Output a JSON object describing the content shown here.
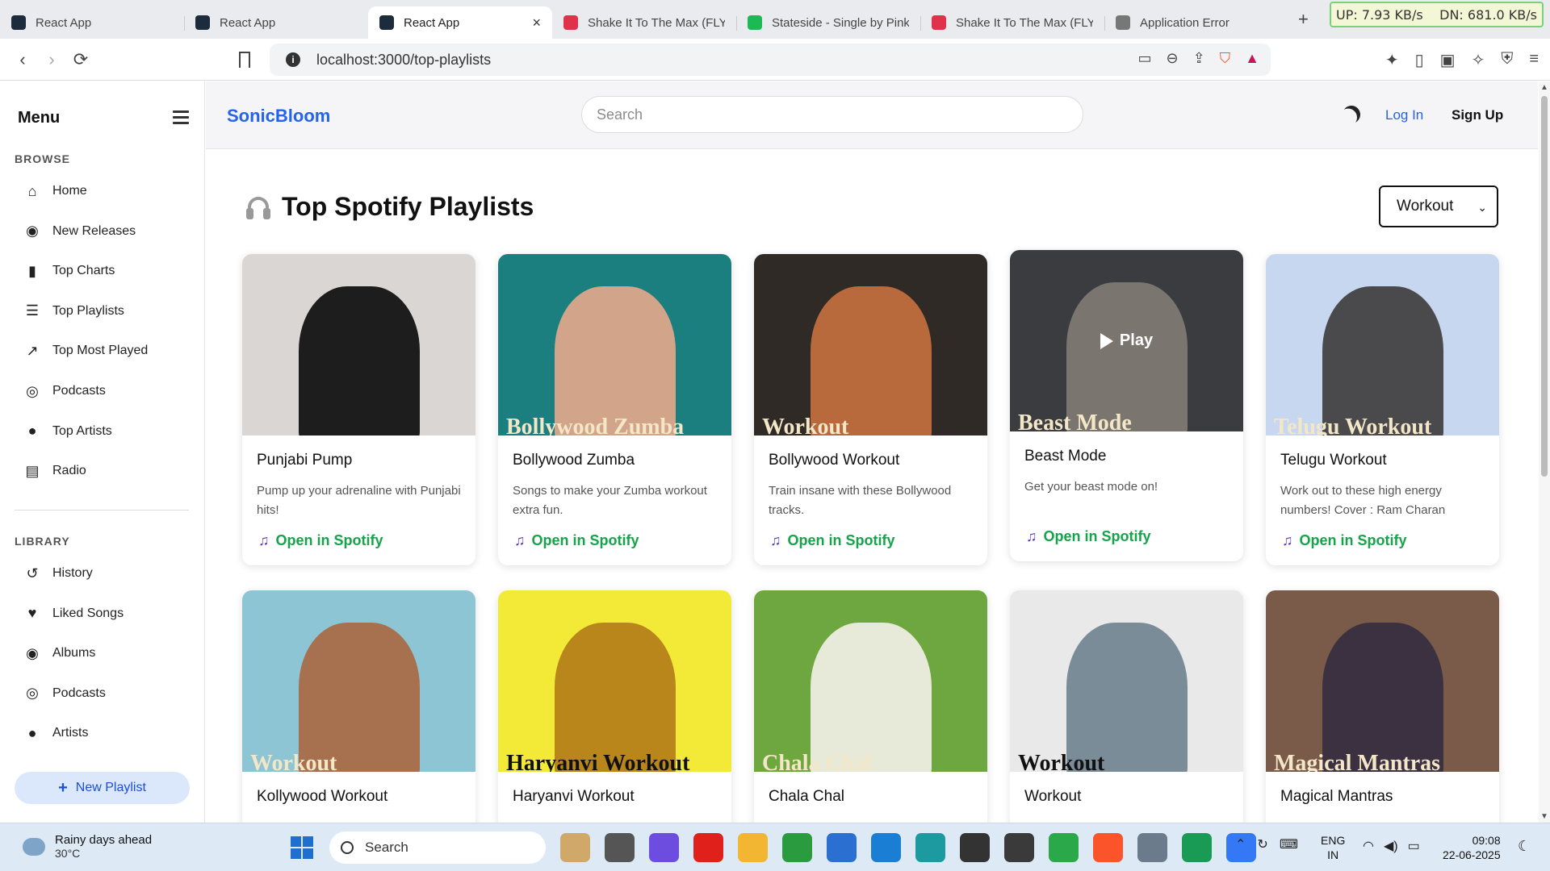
{
  "browser": {
    "tabs": [
      {
        "title": "React App",
        "favicon_color": "#1c2c3c"
      },
      {
        "title": "React App",
        "favicon_color": "#1c2c3c"
      },
      {
        "title": "React App",
        "favicon_color": "#1c2c3c",
        "active": true
      },
      {
        "title": "Shake It To The Max (FLY",
        "favicon_color": "#e1324b"
      },
      {
        "title": "Stateside - Single by Pink",
        "favicon_color": "#1db954"
      },
      {
        "title": "Shake It To The Max (FLY",
        "favicon_color": "#e1324b"
      },
      {
        "title": "Application Error",
        "favicon_color": "#777777"
      }
    ],
    "net_up": "UP: 7.93 KB/s",
    "net_down": "DN: 681.0 KB/s",
    "url": "localhost:3000/top-playlists",
    "new_tab": "+"
  },
  "sidebar": {
    "menu_title": "Menu",
    "browse_label": "BROWSE",
    "browse_items": [
      {
        "label": "Home",
        "icon": "home-icon"
      },
      {
        "label": "New Releases",
        "icon": "compass-icon"
      },
      {
        "label": "Top Charts",
        "icon": "bar-chart-icon"
      },
      {
        "label": "Top Playlists",
        "icon": "playlist-icon"
      },
      {
        "label": "Top Most Played",
        "icon": "trending-icon"
      },
      {
        "label": "Podcasts",
        "icon": "podcast-icon"
      },
      {
        "label": "Top Artists",
        "icon": "user-icon"
      },
      {
        "label": "Radio",
        "icon": "radio-icon"
      }
    ],
    "library_label": "LIBRARY",
    "library_items": [
      {
        "label": "History",
        "icon": "history-icon"
      },
      {
        "label": "Liked Songs",
        "icon": "heart-icon"
      },
      {
        "label": "Albums",
        "icon": "album-icon"
      },
      {
        "label": "Podcasts",
        "icon": "podcast-icon"
      },
      {
        "label": "Artists",
        "icon": "user-icon"
      }
    ],
    "new_playlist_label": "New Playlist"
  },
  "header": {
    "brand": "SonicBloom",
    "search_placeholder": "Search",
    "login_label": "Log In",
    "signup_label": "Sign Up"
  },
  "main": {
    "title": "Top Spotify Playlists",
    "filter_value": "Workout",
    "open_label": "Open in Spotify",
    "play_label": "Play",
    "playlists": [
      {
        "name": "Punjabi Pump",
        "desc": "Pump up your adrenaline with Punjabi hits!",
        "bg": "#d9d6d3",
        "figure": "#1d1d1d",
        "cover_text": ""
      },
      {
        "name": "Bollywood Zumba",
        "desc": "Songs to make your Zumba workout extra fun.",
        "bg": "#1b7f80",
        "figure": "#d2a58a",
        "cover_text": "Bollywood Zumba"
      },
      {
        "name": "Bollywood Workout",
        "desc": "Train insane with these Bollywood tracks.",
        "bg": "#2f2a25",
        "figure": "#b86a3c",
        "cover_text": "Workout"
      },
      {
        "name": "Beast Mode",
        "desc": "Get your beast mode on!",
        "bg": "#3a3c40",
        "figure": "#7b7570",
        "cover_text": "Beast Mode",
        "hover": true
      },
      {
        "name": "Telugu Workout",
        "desc": "Work out to these high energy numbers! Cover : Ram Charan",
        "bg": "#c7d7ef",
        "figure": "#4a4a4d",
        "cover_text": "Telugu Workout"
      },
      {
        "name": "Kollywood Workout",
        "desc": "",
        "bg": "#8ec5d4",
        "figure": "#a7704e",
        "cover_text": "Workout"
      },
      {
        "name": "Haryanvi Workout",
        "desc": "",
        "bg": "#f3ea38",
        "figure": "#b8861b",
        "cover_text": "Haryanvi Workout"
      },
      {
        "name": "Chala Chal",
        "desc": "",
        "bg": "#6ea63f",
        "figure": "#e8ead9",
        "cover_text": "Chala Chal"
      },
      {
        "name": "Workout",
        "desc": "",
        "bg": "#e9e9e9",
        "figure": "#7b8c99",
        "cover_text": "Workout"
      },
      {
        "name": "Magical Mantras",
        "desc": "",
        "bg": "#7a5a48",
        "figure": "#3c3140",
        "cover_text": "Magical Mantras"
      }
    ]
  },
  "taskbar": {
    "weather_title": "Rainy days ahead",
    "weather_temp": "30°C",
    "search_label": "Search",
    "apps": [
      "#cfa86a",
      "#555555",
      "#6c4de0",
      "#e0211b",
      "#f2b632",
      "#2a9c3f",
      "#2b6fd1",
      "#1a7fd4",
      "#1d9aa0",
      "#333333",
      "#3a3a3a",
      "#2aa84a",
      "#fb542b",
      "#6b7b8c",
      "#1a9b55",
      "#3478f6"
    ],
    "lang_1": "ENG",
    "lang_2": "IN",
    "time": "09:08",
    "date": "22-06-2025"
  }
}
